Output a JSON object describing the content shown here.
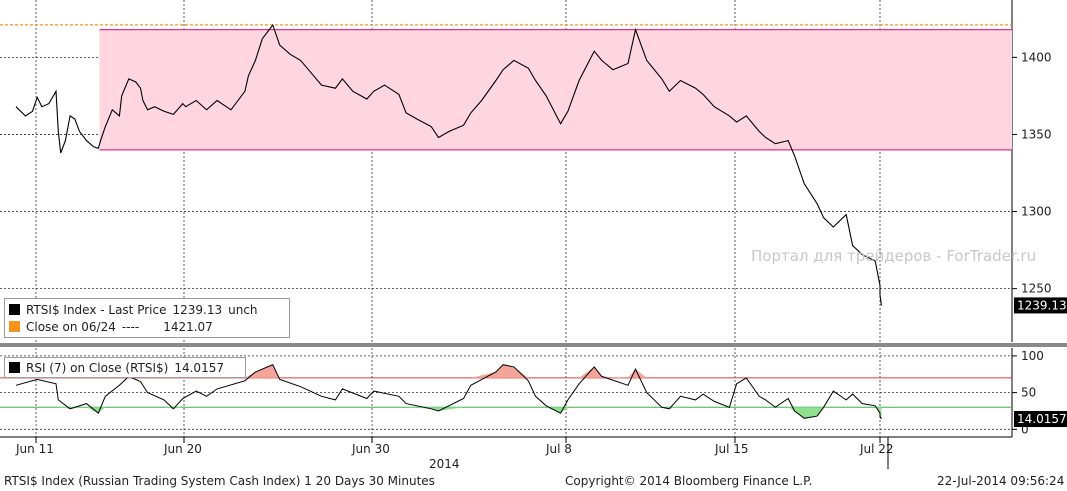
{
  "chart_data": [
    {
      "type": "line",
      "title": "RTSI$ Index - Last Price",
      "ylim": [
        1218,
        1432
      ],
      "y_ticks": [
        1250,
        1300,
        1350,
        1400
      ],
      "grid": true,
      "x_ticks": [
        {
          "label": "Jun 11",
          "date": "2014-06-11"
        },
        {
          "label": "Jun 20",
          "date": "2014-06-20"
        },
        {
          "label": "Jun 30",
          "date": "2014-06-30"
        },
        {
          "label": "Jul 8",
          "date": "2014-07-08"
        },
        {
          "label": "Jul 15",
          "date": "2014-07-15"
        },
        {
          "label": "Jul 22",
          "date": "2014-07-22"
        }
      ],
      "series": [
        {
          "name": "RTSI$ Index - Last Price",
          "last_value": "1239.13",
          "unit": "unch",
          "color": "#000000",
          "points": [
            [
              "2014-06-10 10:00",
              1368
            ],
            [
              "2014-06-10 14:00",
              1362
            ],
            [
              "2014-06-10 17:00",
              1365
            ],
            [
              "2014-06-11 10:00",
              1374
            ],
            [
              "2014-06-11 12:00",
              1368
            ],
            [
              "2014-06-11 15:00",
              1370
            ],
            [
              "2014-06-11 18:00",
              1378
            ],
            [
              "2014-06-12 10:00",
              1352
            ],
            [
              "2014-06-12 11:00",
              1338
            ],
            [
              "2014-06-12 13:00",
              1346
            ],
            [
              "2014-06-12 15:00",
              1362
            ],
            [
              "2014-06-12 17:00",
              1360
            ],
            [
              "2014-06-13 10:00",
              1352
            ],
            [
              "2014-06-13 13:00",
              1346
            ],
            [
              "2014-06-13 16:00",
              1342
            ],
            [
              "2014-06-13 18:00",
              1341
            ],
            [
              "2014-06-16 10:00",
              1346
            ],
            [
              "2014-06-16 12:00",
              1355
            ],
            [
              "2014-06-16 15:00",
              1366
            ],
            [
              "2014-06-16 18:00",
              1362
            ],
            [
              "2014-06-17 10:00",
              1375
            ],
            [
              "2014-06-17 13:00",
              1386
            ],
            [
              "2014-06-17 16:00",
              1384
            ],
            [
              "2014-06-17 18:00",
              1380
            ],
            [
              "2014-06-18 10:00",
              1372
            ],
            [
              "2014-06-18 12:00",
              1366
            ],
            [
              "2014-06-18 15:00",
              1368
            ],
            [
              "2014-06-19 10:00",
              1365
            ],
            [
              "2014-06-19 14:00",
              1363
            ],
            [
              "2014-06-19 18:00",
              1370
            ],
            [
              "2014-06-20 10:00",
              1368
            ],
            [
              "2014-06-20 13:00",
              1372
            ],
            [
              "2014-06-20 16:00",
              1366
            ],
            [
              "2014-06-23 10:00",
              1372
            ],
            [
              "2014-06-23 14:00",
              1366
            ],
            [
              "2014-06-23 18:00",
              1378
            ],
            [
              "2014-06-24 10:00",
              1388
            ],
            [
              "2014-06-24 12:00",
              1398
            ],
            [
              "2014-06-24 14:00",
              1412
            ],
            [
              "2014-06-24 17:00",
              1421
            ],
            [
              "2014-06-25 10:00",
              1408
            ],
            [
              "2014-06-25 13:00",
              1402
            ],
            [
              "2014-06-25 16:00",
              1398
            ],
            [
              "2014-06-26 10:00",
              1390
            ],
            [
              "2014-06-26 13:00",
              1382
            ],
            [
              "2014-06-26 17:00",
              1380
            ],
            [
              "2014-06-27 10:00",
              1386
            ],
            [
              "2014-06-27 13:00",
              1378
            ],
            [
              "2014-06-27 17:00",
              1373
            ],
            [
              "2014-06-30 10:00",
              1378
            ],
            [
              "2014-06-30 13:00",
              1382
            ],
            [
              "2014-06-30 17:00",
              1376
            ],
            [
              "2014-07-01 10:00",
              1364
            ],
            [
              "2014-07-01 13:00",
              1360
            ],
            [
              "2014-07-01 17:00",
              1355
            ],
            [
              "2014-07-02 10:00",
              1348
            ],
            [
              "2014-07-02 13:00",
              1352
            ],
            [
              "2014-07-02 17:00",
              1356
            ],
            [
              "2014-07-03 10:00",
              1364
            ],
            [
              "2014-07-03 13:00",
              1372
            ],
            [
              "2014-07-03 17:00",
              1385
            ],
            [
              "2014-07-04 10:00",
              1392
            ],
            [
              "2014-07-04 13:00",
              1398
            ],
            [
              "2014-07-04 17:00",
              1393
            ],
            [
              "2014-07-07 10:00",
              1385
            ],
            [
              "2014-07-07 13:00",
              1375
            ],
            [
              "2014-07-07 17:00",
              1357
            ],
            [
              "2014-07-08 10:00",
              1365
            ],
            [
              "2014-07-08 13:00",
              1385
            ],
            [
              "2014-07-08 17:00",
              1404
            ],
            [
              "2014-07-09 10:00",
              1398
            ],
            [
              "2014-07-09 13:00",
              1392
            ],
            [
              "2014-07-09 17:00",
              1396
            ],
            [
              "2014-07-10 10:00",
              1418
            ],
            [
              "2014-07-10 13:00",
              1398
            ],
            [
              "2014-07-10 17:00",
              1386
            ],
            [
              "2014-07-11 10:00",
              1378
            ],
            [
              "2014-07-11 13:00",
              1385
            ],
            [
              "2014-07-11 17:00",
              1380
            ],
            [
              "2014-07-14 10:00",
              1376
            ],
            [
              "2014-07-14 13:00",
              1368
            ],
            [
              "2014-07-14 17:00",
              1362
            ],
            [
              "2014-07-15 10:00",
              1358
            ],
            [
              "2014-07-15 13:00",
              1362
            ],
            [
              "2014-07-15 17:00",
              1352
            ],
            [
              "2014-07-16 10:00",
              1348
            ],
            [
              "2014-07-16 13:00",
              1344
            ],
            [
              "2014-07-16 17:00",
              1346
            ],
            [
              "2014-07-17 10:00",
              1336
            ],
            [
              "2014-07-17 13:00",
              1318
            ],
            [
              "2014-07-17 17:00",
              1305
            ],
            [
              "2014-07-18 10:00",
              1296
            ],
            [
              "2014-07-18 13:00",
              1290
            ],
            [
              "2014-07-18 17:00",
              1298
            ],
            [
              "2014-07-21 10:00",
              1278
            ],
            [
              "2014-07-21 13:00",
              1272
            ],
            [
              "2014-07-21 17:00",
              1268
            ],
            [
              "2014-07-22 09:00",
              1252
            ],
            [
              "2014-07-22 09:30",
              1246
            ],
            [
              "2014-07-22 09:56",
              1239.13
            ]
          ]
        },
        {
          "name": "Close on 06/24",
          "value": "1421.07",
          "date_label": "----",
          "color": "#f7941d"
        }
      ]
    },
    {
      "type": "line",
      "title": "RSI (7) on Close (RTSI$)",
      "ylim": [
        -5,
        108
      ],
      "y_ticks": [
        0,
        50,
        100
      ],
      "thresholds": [
        70,
        30
      ],
      "series": [
        {
          "name": "RSI (7) on Close (RTSI$)",
          "last_value": "14.0157",
          "color": "#000000",
          "points": [
            [
              "2014-06-10 10:00",
              60
            ],
            [
              "2014-06-11 10:00",
              68
            ],
            [
              "2014-06-11 18:00",
              62
            ],
            [
              "2014-06-12 10:00",
              40
            ],
            [
              "2014-06-12 15:00",
              28
            ],
            [
              "2014-06-13 13:00",
              35
            ],
            [
              "2014-06-13 18:00",
              22
            ],
            [
              "2014-06-16 12:00",
              45
            ],
            [
              "2014-06-16 18:00",
              60
            ],
            [
              "2014-06-17 13:00",
              72
            ],
            [
              "2014-06-17 18:00",
              65
            ],
            [
              "2014-06-18 12:00",
              50
            ],
            [
              "2014-06-19 10:00",
              40
            ],
            [
              "2014-06-19 14:00",
              28
            ],
            [
              "2014-06-19 18:00",
              42
            ],
            [
              "2014-06-20 13:00",
              52
            ],
            [
              "2014-06-20 16:00",
              45
            ],
            [
              "2014-06-23 10:00",
              55
            ],
            [
              "2014-06-23 18:00",
              66
            ],
            [
              "2014-06-24 12:00",
              78
            ],
            [
              "2014-06-24 17:00",
              88
            ],
            [
              "2014-06-25 10:00",
              68
            ],
            [
              "2014-06-25 16:00",
              58
            ],
            [
              "2014-06-26 13:00",
              45
            ],
            [
              "2014-06-26 17:00",
              40
            ],
            [
              "2014-06-27 10:00",
              55
            ],
            [
              "2014-06-27 17:00",
              42
            ],
            [
              "2014-06-30 10:00",
              52
            ],
            [
              "2014-06-30 17:00",
              45
            ],
            [
              "2014-07-01 10:00",
              35
            ],
            [
              "2014-07-01 17:00",
              28
            ],
            [
              "2014-07-02 10:00",
              25
            ],
            [
              "2014-07-02 17:00",
              42
            ],
            [
              "2014-07-03 10:00",
              60
            ],
            [
              "2014-07-03 17:00",
              78
            ],
            [
              "2014-07-04 10:00",
              88
            ],
            [
              "2014-07-04 13:00",
              85
            ],
            [
              "2014-07-04 17:00",
              66
            ],
            [
              "2014-07-07 10:00",
              45
            ],
            [
              "2014-07-07 13:00",
              32
            ],
            [
              "2014-07-07 17:00",
              22
            ],
            [
              "2014-07-08 10:00",
              40
            ],
            [
              "2014-07-08 13:00",
              62
            ],
            [
              "2014-07-08 17:00",
              85
            ],
            [
              "2014-07-09 10:00",
              72
            ],
            [
              "2014-07-09 17:00",
              60
            ],
            [
              "2014-07-10 10:00",
              82
            ],
            [
              "2014-07-10 13:00",
              50
            ],
            [
              "2014-07-10 17:00",
              30
            ],
            [
              "2014-07-11 10:00",
              28
            ],
            [
              "2014-07-11 13:00",
              45
            ],
            [
              "2014-07-11 17:00",
              40
            ],
            [
              "2014-07-14 10:00",
              48
            ],
            [
              "2014-07-14 13:00",
              38
            ],
            [
              "2014-07-14 17:00",
              30
            ],
            [
              "2014-07-15 10:00",
              62
            ],
            [
              "2014-07-15 13:00",
              70
            ],
            [
              "2014-07-15 17:00",
              45
            ],
            [
              "2014-07-16 10:00",
              40
            ],
            [
              "2014-07-16 13:00",
              30
            ],
            [
              "2014-07-16 17:00",
              42
            ],
            [
              "2014-07-17 10:00",
              25
            ],
            [
              "2014-07-17 13:00",
              15
            ],
            [
              "2014-07-17 17:00",
              18
            ],
            [
              "2014-07-18 10:00",
              30
            ],
            [
              "2014-07-18 13:00",
              52
            ],
            [
              "2014-07-18 17:00",
              40
            ],
            [
              "2014-07-21 10:00",
              48
            ],
            [
              "2014-07-21 13:00",
              35
            ],
            [
              "2014-07-21 17:00",
              32
            ],
            [
              "2014-07-22 09:00",
              22
            ],
            [
              "2014-07-22 09:30",
              18
            ],
            [
              "2014-07-22 09:56",
              14.0157
            ]
          ]
        }
      ]
    }
  ],
  "legend": {
    "price_label": "RTSI$ Index - Last Price",
    "price_value": "1239.13",
    "price_unit": "unch",
    "close_label": "Close on 06/24",
    "close_dashes": "----",
    "close_value": "1421.07",
    "rsi_label": "RSI (7) on Close (RTSI$)",
    "rsi_value": "14.0157"
  },
  "badges": {
    "price": "1239.13",
    "rsi": "14.0157"
  },
  "axis": {
    "year_label": "2014"
  },
  "watermark": "Портал для трейдеров - ForTrader.ru",
  "footer": {
    "left": "RTSI$ Index (Russian Trading System Cash Index) 1 20 Days 30 Minutes",
    "center": "Copyright© 2014 Bloomberg Finance L.P.",
    "right": "22-Jul-2014 09:56:24"
  },
  "colors": {
    "band_fill": "#fdd6e2",
    "band_line": "#e0338a",
    "close_line": "#f7941d",
    "rsi_upper": "#e03b3b",
    "rsi_lower": "#3cb44a",
    "rsi_upper_fill": "#f4a59a",
    "rsi_lower_fill": "#8fe08f",
    "badge_bg": "#000000"
  }
}
